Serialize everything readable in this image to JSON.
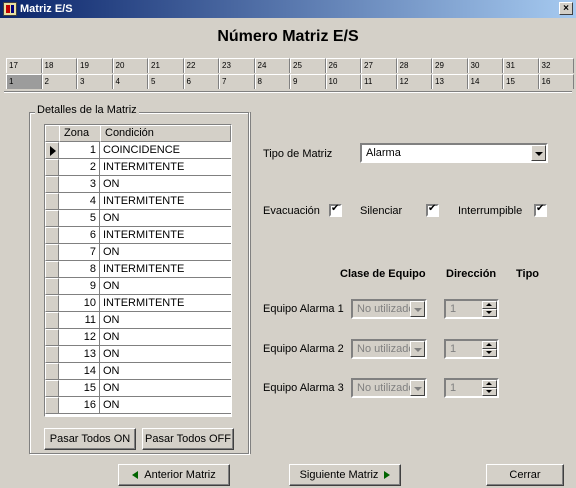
{
  "window": {
    "title": "Matriz E/S"
  },
  "heading": "Número Matriz E/S",
  "tabs": {
    "row1": [
      "17",
      "18",
      "19",
      "20",
      "21",
      "22",
      "23",
      "24",
      "25",
      "26",
      "27",
      "28",
      "29",
      "30",
      "31",
      "32"
    ],
    "row2": [
      "1",
      "2",
      "3",
      "4",
      "5",
      "6",
      "7",
      "8",
      "9",
      "10",
      "11",
      "12",
      "13",
      "14",
      "15",
      "16"
    ],
    "active": "1"
  },
  "details": {
    "group_label": "Detalles de la Matriz",
    "columns": [
      "Zona",
      "Condición"
    ],
    "rows": [
      {
        "zona": "1",
        "condicion": "COINCIDENCE"
      },
      {
        "zona": "2",
        "condicion": "INTERMITENTE"
      },
      {
        "zona": "3",
        "condicion": "ON"
      },
      {
        "zona": "4",
        "condicion": "INTERMITENTE"
      },
      {
        "zona": "5",
        "condicion": "ON"
      },
      {
        "zona": "6",
        "condicion": "INTERMITENTE"
      },
      {
        "zona": "7",
        "condicion": "ON"
      },
      {
        "zona": "8",
        "condicion": "INTERMITENTE"
      },
      {
        "zona": "9",
        "condicion": "ON"
      },
      {
        "zona": "10",
        "condicion": "INTERMITENTE"
      },
      {
        "zona": "11",
        "condicion": "ON"
      },
      {
        "zona": "12",
        "condicion": "ON"
      },
      {
        "zona": "13",
        "condicion": "ON"
      },
      {
        "zona": "14",
        "condicion": "ON"
      },
      {
        "zona": "15",
        "condicion": "ON"
      },
      {
        "zona": "16",
        "condicion": "ON"
      }
    ],
    "pasar_on_label": "Pasar Todos ON",
    "pasar_off_label": "Pasar Todos OFF"
  },
  "config": {
    "tipo_label": "Tipo de Matriz",
    "tipo_value": "Alarma",
    "evacuacion_label": "Evacuación",
    "silenciar_label": "Silenciar",
    "interrumpible_label": "Interrumpible",
    "evacuacion_checked": true,
    "silenciar_checked": true,
    "interrumpible_checked": true,
    "col_clase": "Clase de Equipo",
    "col_direccion": "Dirección",
    "col_tipo": "Tipo",
    "equipos": [
      {
        "label": "Equipo Alarma 1",
        "clase": "No utilizado",
        "direccion": "1"
      },
      {
        "label": "Equipo Alarma 2",
        "clase": "No utilizado",
        "direccion": "1"
      },
      {
        "label": "Equipo Alarma 3",
        "clase": "No utilizado",
        "direccion": "1"
      }
    ]
  },
  "footer": {
    "anterior_label": "Anterior Matriz",
    "siguiente_label": "Siguiente Matriz",
    "cerrar_label": "Cerrar"
  },
  "icons": {
    "app": "matrix-app-icon",
    "close": "close-icon",
    "prev": "arrow-left-icon",
    "next": "arrow-right-icon"
  },
  "colors": {
    "titlebar_start": "#0a246a",
    "titlebar_end": "#a6caf0",
    "face": "#d4d0c8",
    "arrow": "#006400"
  }
}
